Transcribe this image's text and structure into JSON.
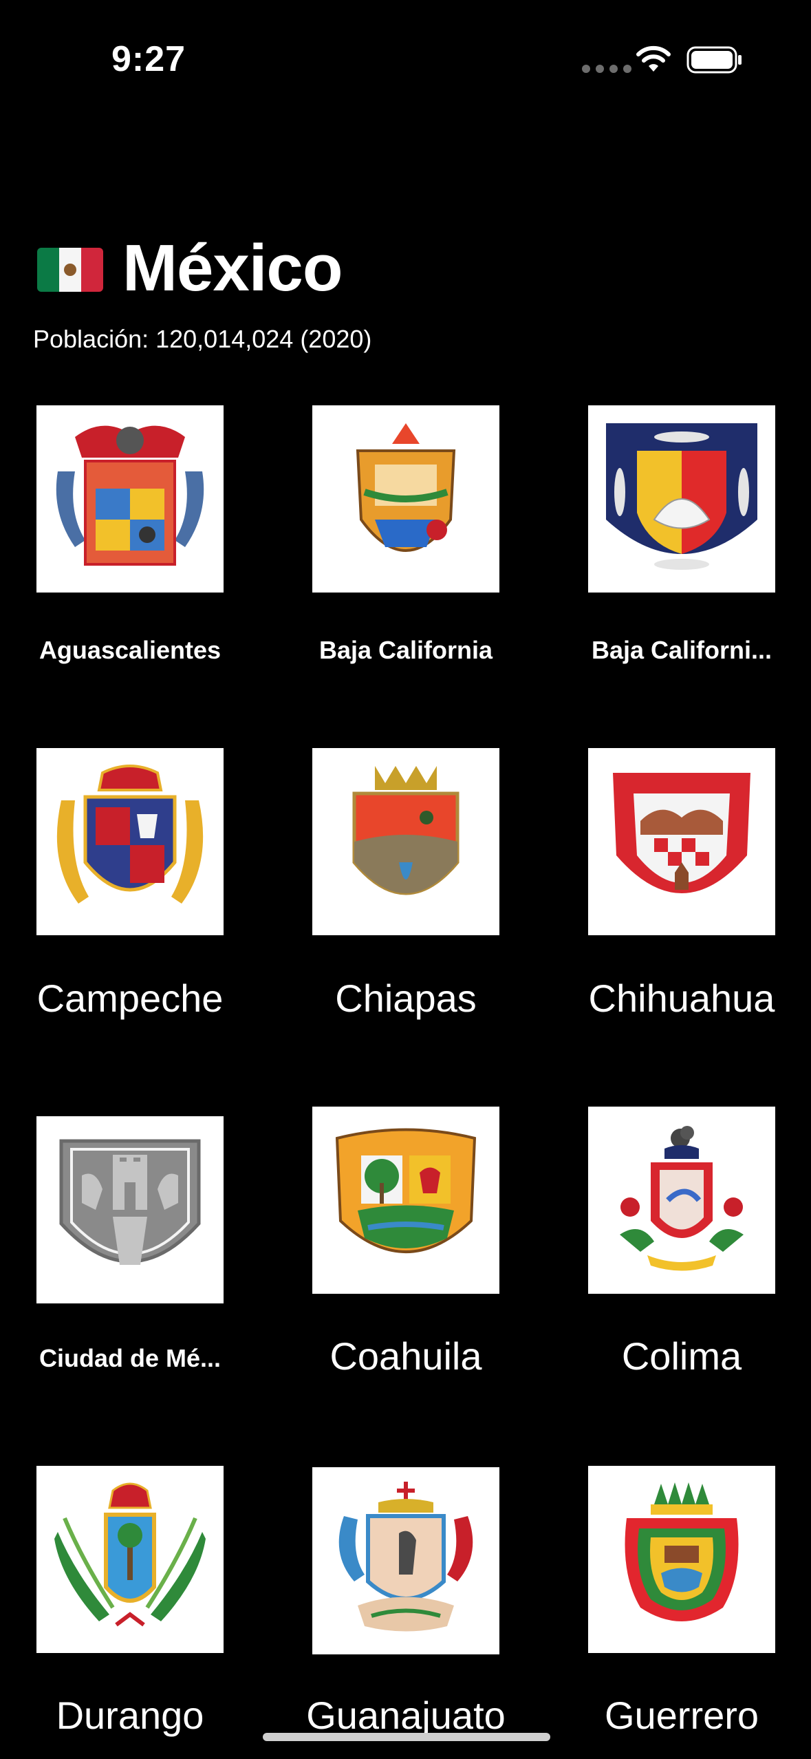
{
  "status_bar": {
    "time": "9:27",
    "icons": [
      "signal-dots-icon",
      "wifi-icon",
      "battery-icon"
    ]
  },
  "header": {
    "flag_icon": "mexico-flag-icon",
    "title": "México",
    "population": "Población: 120,014,024 (2020)"
  },
  "states": [
    {
      "name": "Aguascalientes",
      "icon": "aguascalientes-coat-of-arms-icon",
      "color": "#e45b3a"
    },
    {
      "name": "Baja California",
      "icon": "baja-california-coat-of-arms-icon",
      "color": "#e89c2c"
    },
    {
      "name": "Baja Californi...",
      "icon": "baja-california-sur-coat-of-arms-icon",
      "color": "#1f2d6b"
    },
    {
      "name": "Campeche",
      "icon": "campeche-coat-of-arms-icon",
      "color": "#2f3e8c"
    },
    {
      "name": "Chiapas",
      "icon": "chiapas-coat-of-arms-icon",
      "color": "#e8462b"
    },
    {
      "name": "Chihuahua",
      "icon": "chihuahua-coat-of-arms-icon",
      "color": "#d8262e"
    },
    {
      "name": "Ciudad de Mé...",
      "icon": "ciudad-de-mexico-coat-of-arms-icon",
      "color": "#8a8a8a"
    },
    {
      "name": "Coahuila",
      "icon": "coahuila-coat-of-arms-icon",
      "color": "#f2a32a"
    },
    {
      "name": "Colima",
      "icon": "colima-coat-of-arms-icon",
      "color": "#d8262e"
    },
    {
      "name": "Durango",
      "icon": "durango-coat-of-arms-icon",
      "color": "#2f8a3a"
    },
    {
      "name": "Guanajuato",
      "icon": "guanajuato-coat-of-arms-icon",
      "color": "#3a8ac8"
    },
    {
      "name": "Guerrero",
      "icon": "guerrero-coat-of-arms-icon",
      "color": "#e2262e"
    }
  ]
}
